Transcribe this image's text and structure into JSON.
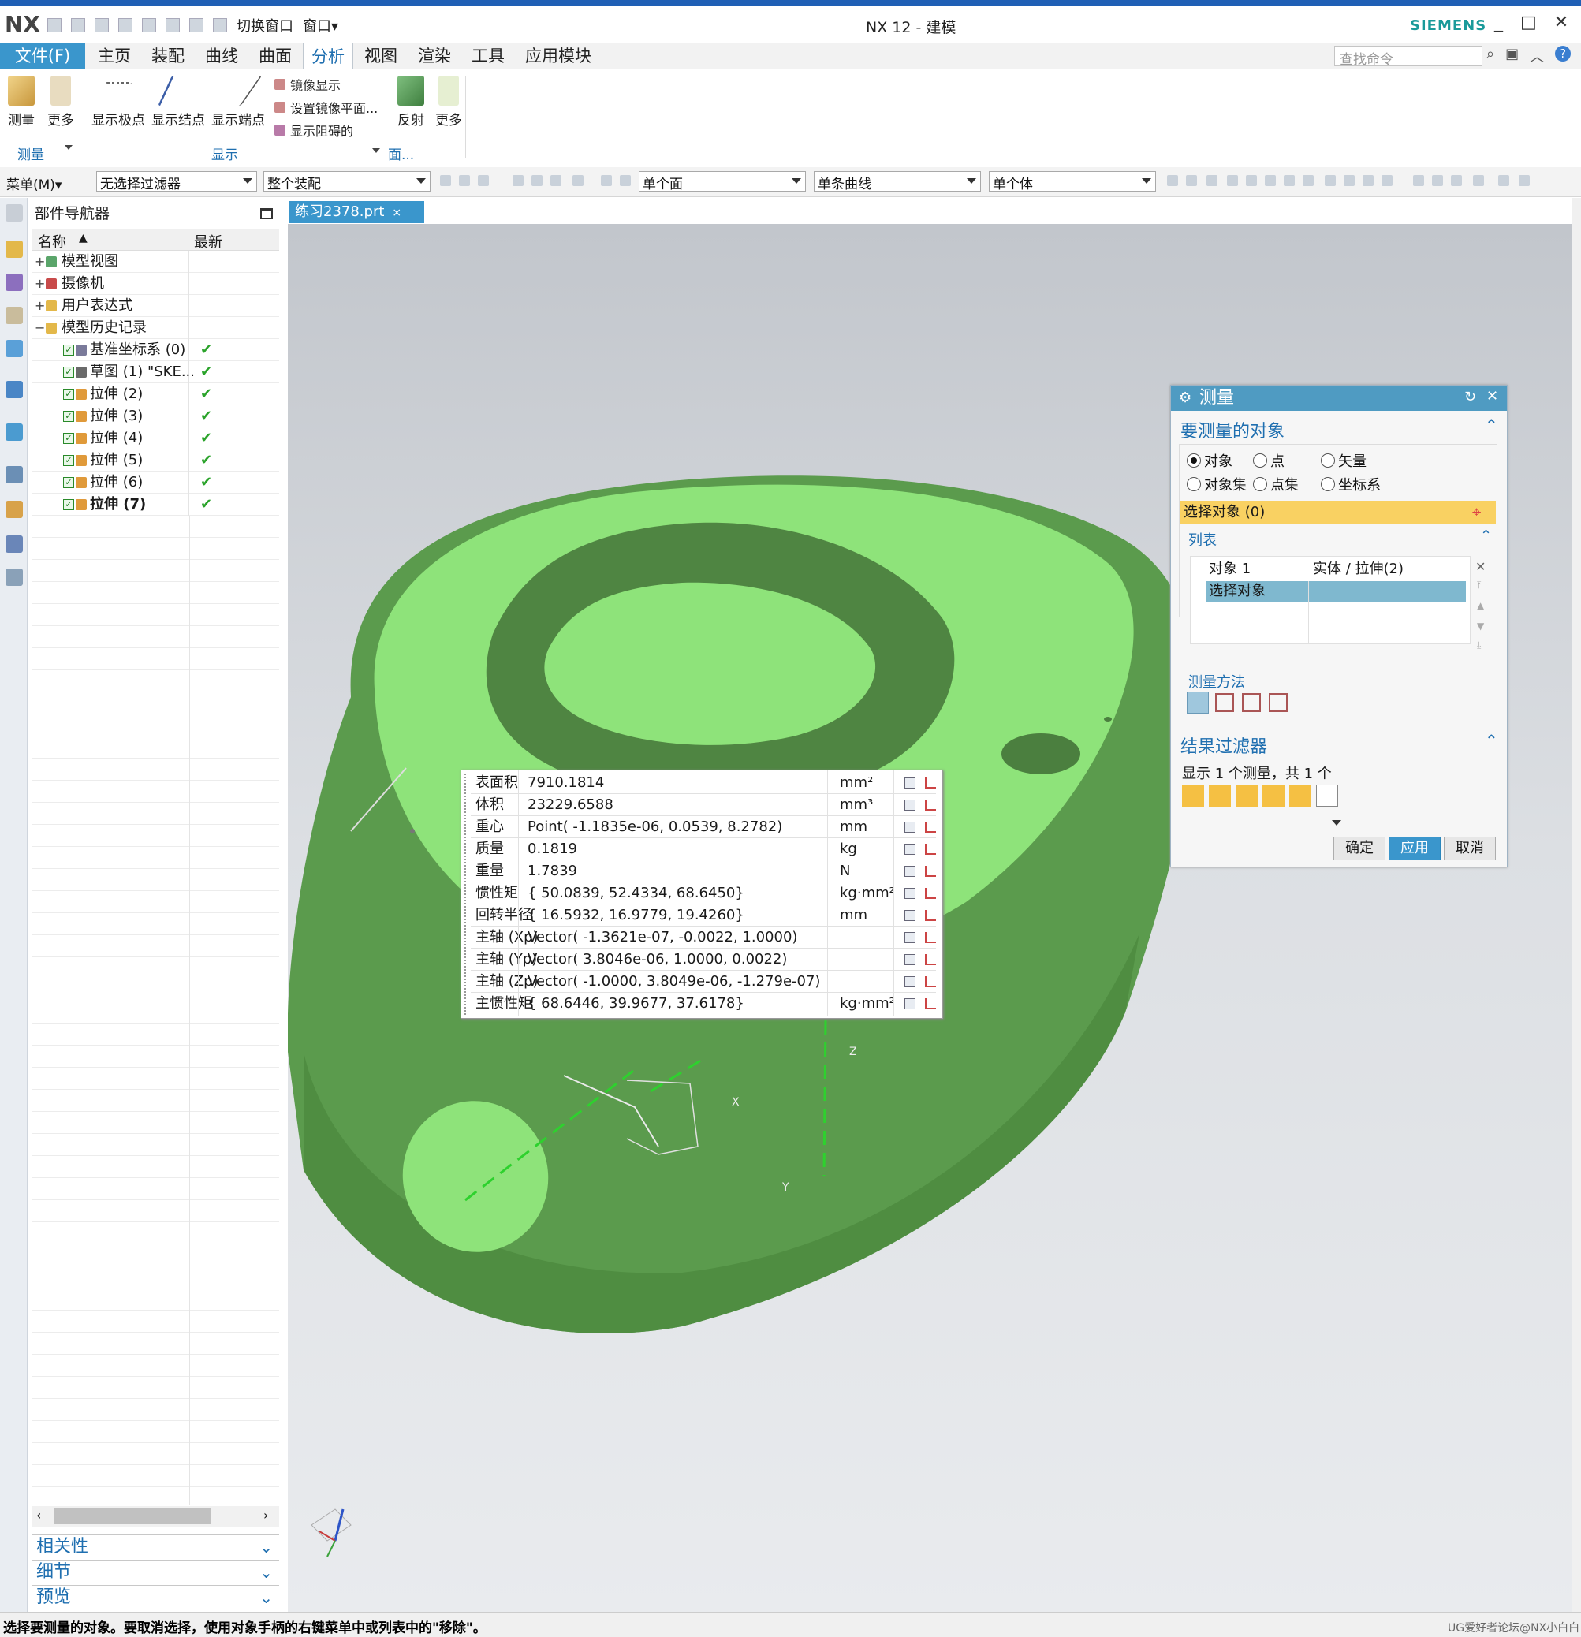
{
  "app": {
    "logo": "NX",
    "title": "NX 12 - 建模",
    "brand": "SIEMENS",
    "switch_window": "切换窗口",
    "window": "窗口▾"
  },
  "menu": {
    "file": "文件(F)",
    "tabs": [
      "主页",
      "装配",
      "曲线",
      "曲面",
      "分析",
      "视图",
      "渲染",
      "工具",
      "应用模块"
    ],
    "active": "分析",
    "search_placeholder": "查找命令"
  },
  "ribbon": {
    "measure": "测量",
    "more": "更多",
    "show_poles": "显示极点",
    "show_knots": "显示结点",
    "show_endpoints": "显示端点",
    "mirror_display": "镜像显示",
    "set_mirror_plane": "设置镜像平面...",
    "show_blocking": "显示阻碍的",
    "reflect": "反射",
    "more2": "更多",
    "group_measure": "测量",
    "group_display": "显示",
    "group_face": "面..."
  },
  "selection": {
    "menu": "菜单(M)▾",
    "filter": "无选择过滤器",
    "assembly": "整个装配",
    "face": "单个面",
    "curve": "单条曲线",
    "body": "单个体"
  },
  "navigator": {
    "title": "部件导航器",
    "col_name": "名称",
    "col_latest": "最新",
    "items": [
      {
        "label": "模型视图",
        "exp": "+"
      },
      {
        "label": "摄像机",
        "exp": "+"
      },
      {
        "label": "用户表达式",
        "exp": "+"
      },
      {
        "label": "模型历史记录",
        "exp": "−"
      },
      {
        "label": "基准坐标系 (0)",
        "ok": "✔"
      },
      {
        "label": "草图 (1) \"SKE...",
        "ok": "✔"
      },
      {
        "label": "拉伸 (2)",
        "ok": "✔"
      },
      {
        "label": "拉伸 (3)",
        "ok": "✔"
      },
      {
        "label": "拉伸 (4)",
        "ok": "✔"
      },
      {
        "label": "拉伸 (5)",
        "ok": "✔"
      },
      {
        "label": "拉伸 (6)",
        "ok": "✔"
      },
      {
        "label": "拉伸 (7)",
        "ok": "✔"
      }
    ],
    "panels": [
      "相关性",
      "细节",
      "预览"
    ]
  },
  "doc_tab": "练习2378.prt",
  "measure_dialog": {
    "title": "测量",
    "section_objects": "要测量的对象",
    "radios": [
      "对象",
      "点",
      "矢量",
      "对象集",
      "点集",
      "坐标系"
    ],
    "selected_radio": "对象",
    "select_object": "选择对象 (0)",
    "list_label": "列表",
    "list_rows": [
      {
        "a": "对象 1",
        "b": "实体 / 拉伸(2)"
      },
      {
        "a": "选择对象",
        "b": ""
      }
    ],
    "method_label": "测量方法",
    "section_filter": "结果过滤器",
    "filter_text": "显示 1 个测量，共 1 个",
    "ok": "确定",
    "apply": "应用",
    "cancel": "取消"
  },
  "results": [
    {
      "name": "表面积",
      "value": "7910.1814",
      "unit": "mm²"
    },
    {
      "name": "体积",
      "value": "23229.6588",
      "unit": "mm³"
    },
    {
      "name": "重心",
      "value": "Point( -1.1835e-06, 0.0539, 8.2782)",
      "unit": "mm"
    },
    {
      "name": "质量",
      "value": "0.1819",
      "unit": "kg"
    },
    {
      "name": "重量",
      "value": "1.7839",
      "unit": "N"
    },
    {
      "name": "惯性矩",
      "value": "{ 50.0839, 52.4334, 68.6450}",
      "unit": "kg·mm²"
    },
    {
      "name": "回转半径",
      "value": "{ 16.5932, 16.9779, 19.4260}",
      "unit": "mm"
    },
    {
      "name": "主轴 (Xp)",
      "value": "Vector( -1.3621e-07, -0.0022, 1.0000)",
      "unit": ""
    },
    {
      "name": "主轴 (Yp)",
      "value": "Vector( 3.8046e-06, 1.0000, 0.0022)",
      "unit": ""
    },
    {
      "name": "主轴 (Zp)",
      "value": "Vector( -1.0000, 3.8049e-06, -1.279e-07)",
      "unit": ""
    },
    {
      "name": "主惯性矩",
      "value": "{ 68.6446, 39.9677, 37.6178}",
      "unit": "kg·mm²"
    }
  ],
  "status": "选择要测量的对象。要取消选择，使用对象手柄的右键菜单中或列表中的\"移除\"。",
  "watermark": "UG爱好者论坛@NX小白白",
  "axis_labels": {
    "x": "X",
    "y": "Y",
    "z": "Z"
  },
  "colors": {
    "accent": "#3a96cc",
    "model_top": "#8ee37a",
    "model_side": "#5a9c4c"
  }
}
